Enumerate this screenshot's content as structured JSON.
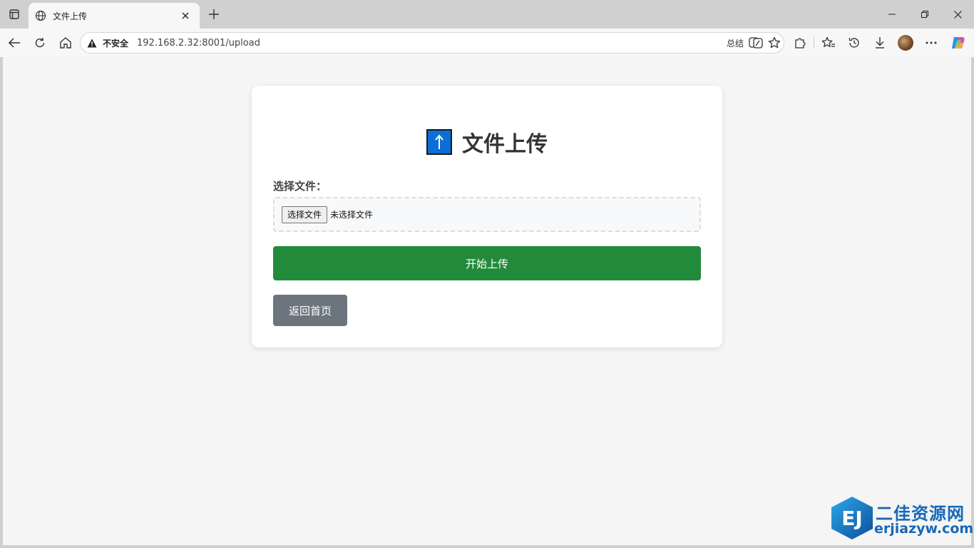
{
  "browser": {
    "tab": {
      "title": "文件上传"
    },
    "address": {
      "security_label": "不安全",
      "url": "192.168.2.32:8001/upload",
      "summary_label": "总结"
    }
  },
  "page": {
    "heading": "文件上传",
    "file_label": "选择文件：",
    "file_button": "选择文件",
    "file_status": "未选择文件",
    "upload_button": "开始上传",
    "home_button": "返回首页"
  },
  "watermark": {
    "logo_text": "EJ",
    "name": "二佳资源网",
    "domain": "erjiazyw.com"
  },
  "colors": {
    "upload_button": "#228b3b",
    "home_button": "#6c757d",
    "upload_icon": "#0a6fd6"
  }
}
